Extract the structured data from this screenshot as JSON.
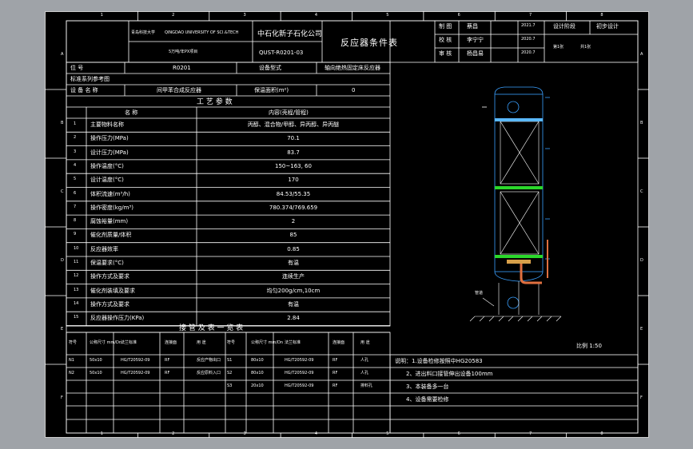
{
  "zones": {
    "top": [
      "1",
      "2",
      "3",
      "4",
      "5",
      "6",
      "7",
      "8"
    ],
    "left": [
      "A",
      "B",
      "C",
      "D",
      "E",
      "F"
    ]
  },
  "title_block": {
    "school": "青岛科技大学",
    "school_en": "QINGDAO UNIVERSITY OF SCI.&TECH",
    "project": "5万吨/年PX项目",
    "company": "中石化新子石化公司",
    "drawing_no": "QUST-R0201-03",
    "title": "反应器条件表",
    "roles": [
      {
        "label": "制 图",
        "name": "蔡昌",
        "date": "2021.7"
      },
      {
        "label": "校 核",
        "name": "李宁宁",
        "date": "2020.7"
      },
      {
        "label": "审 核",
        "name": "杨昌易",
        "date": "2020.7"
      }
    ],
    "stage_label": "设计阶段",
    "stage_value": "初步设计",
    "sheet_label": "第1张",
    "sheet_total": "共1张"
  },
  "equipment": {
    "tag_label": "位 号",
    "tag": "R0201",
    "type_label": "设备型式",
    "type_value": "轴向绝热固定床反应器",
    "std_label": "标准系列参考图",
    "name_label": "设 备 名 称",
    "name_value": "间甲苯合成反应器",
    "insul_label": "保温面积(m²)",
    "insul_value": "0"
  },
  "process": {
    "section_title": "工 艺 参 数",
    "col_name": "名 称",
    "col_value": "内容(壳程/管程)",
    "rows": [
      {
        "no": "1",
        "name": "主要物料名称",
        "value": "丙醇、混合物/甲醇、异丙醇、异丙醚"
      },
      {
        "no": "2",
        "name": "操作压力(MPa)",
        "value": "70.1"
      },
      {
        "no": "3",
        "name": "设计压力(MPa)",
        "value": "83.7"
      },
      {
        "no": "4",
        "name": "操作温度(°C)",
        "value": "150~163, 60"
      },
      {
        "no": "5",
        "name": "设计温度(°C)",
        "value": "170"
      },
      {
        "no": "6",
        "name": "体积流速(m³/h)",
        "value": "84.53/55.35"
      },
      {
        "no": "7",
        "name": "操作密度(kg/m³)",
        "value": "780.374/769.659"
      },
      {
        "no": "8",
        "name": "腐蚀裕量(mm)",
        "value": "2"
      },
      {
        "no": "9",
        "name": "催化剂质量/体积",
        "value": "85"
      },
      {
        "no": "10",
        "name": "反应器效率",
        "value": "0.85"
      },
      {
        "no": "11",
        "name": "保温要求(°C)",
        "value": "有温"
      },
      {
        "no": "12",
        "name": "操作方式及要求",
        "value": "连续生产"
      },
      {
        "no": "13",
        "name": "催化剂装填及要求",
        "value": "均匀200g/cm,10cm"
      },
      {
        "no": "14",
        "name": "操作方式及要求",
        "value": "有温"
      },
      {
        "no": "15",
        "name": "反应器操作压力(KPa)",
        "value": "2.84"
      }
    ]
  },
  "nozzles": {
    "title": "接 管 及 表 一 览 表",
    "headers": [
      "符号",
      "公称尺寸 mm/Dn",
      "法兰标准",
      "连接面",
      "用 途",
      "符号",
      "公称尺寸 mm/Dn",
      "法兰标准",
      "连接面",
      "用 途"
    ],
    "left_rows": [
      {
        "sym": "N1",
        "size": "50x10",
        "std": "HG/T20592-09",
        "face": "RF",
        "use": "反应产物出口"
      },
      {
        "sym": "N2",
        "size": "50x10",
        "std": "HG/T20592-09",
        "face": "RF",
        "use": "反应原料入口"
      }
    ],
    "right_rows": [
      {
        "sym": "S1",
        "size": "80x10",
        "std": "HG/T20592-09",
        "face": "RF",
        "use": "人孔"
      },
      {
        "sym": "S2",
        "size": "80x10",
        "std": "HG/T20592-09",
        "face": "RF",
        "use": "人孔"
      },
      {
        "sym": "S3",
        "size": "20x10",
        "std": "HG/T20592-09",
        "face": "RF",
        "use": "排料孔"
      }
    ]
  },
  "notes": {
    "header": "说明：1.设备检修按照中HG20583",
    "items": [
      "2、进出料口接管伸出设备100mm",
      "3、本装备多一台",
      "4、设备需要检修"
    ]
  },
  "drawing": {
    "scale": "比例 1:50",
    "annotation": "管道"
  }
}
